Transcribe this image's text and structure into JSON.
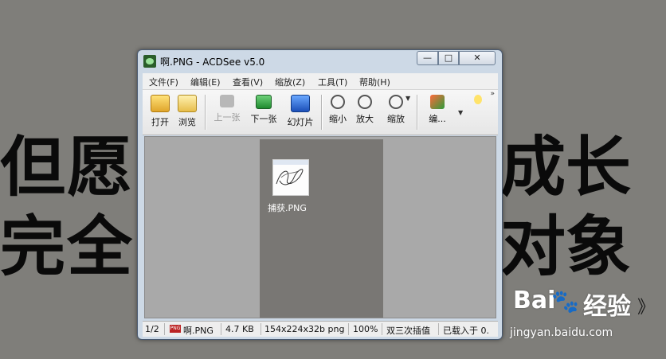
{
  "background": {
    "line1_left": "但愿",
    "line1_right": "成长",
    "line2_left": "完全",
    "line2_right": "对象"
  },
  "watermark": {
    "logo": "Bai",
    "logo_suffix": "经验",
    "site": "jingyan.baidu.com",
    "deco": "》"
  },
  "window": {
    "title": "啊.PNG - ACDSee v5.0",
    "buttons": {
      "minimize": "—",
      "maximize": "□",
      "close": "✕"
    }
  },
  "menu": [
    "文件(F)",
    "编辑(E)",
    "查看(V)",
    "缩放(Z)",
    "工具(T)",
    "帮助(H)"
  ],
  "toolbar": {
    "open": "打开",
    "browse": "浏览",
    "prev": "上一张",
    "next": "下一张",
    "slideshow": "幻灯片",
    "zoom_out": "缩小",
    "zoom_in": "放大",
    "zoom": "缩放",
    "edit": "编...",
    "more": "»"
  },
  "thumbnail": {
    "label": "捕获.PNG"
  },
  "status": {
    "page": "1/2",
    "filename": "啊.PNG",
    "filesize": "4.7 KB",
    "dimensions": "154x224x32b png",
    "zoom": "100%",
    "interp": "双三次插值",
    "loaded": "已载入于 0."
  },
  "colors": {
    "desktop_bg": "#7f7e7a",
    "window_frame": "#cdd9e6",
    "content_bg": "#a9a9a9",
    "image_bg": "#797774"
  }
}
